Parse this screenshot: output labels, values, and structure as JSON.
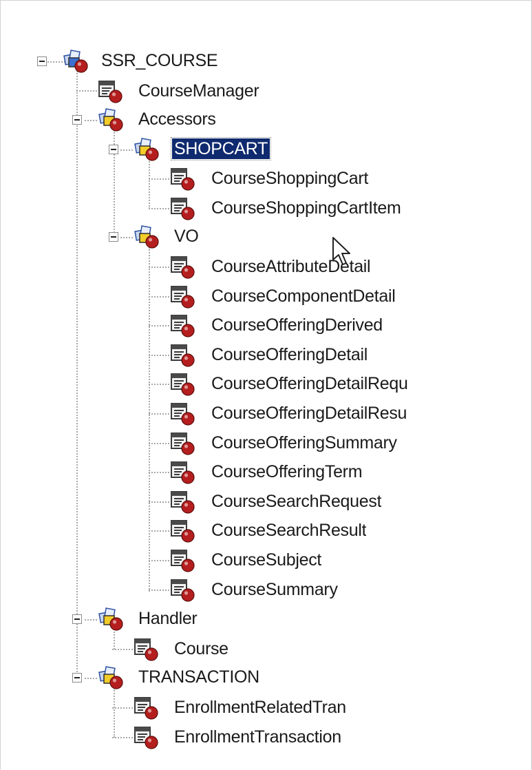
{
  "tree": {
    "root": {
      "label": "SSR_COURSE",
      "icon": "package-icon",
      "expanded": true
    },
    "course_manager": {
      "label": "CourseManager",
      "icon": "class-icon"
    },
    "accessors": {
      "label": "Accessors",
      "icon": "package-icon",
      "expanded": true
    },
    "shopcart": {
      "label": "SHOPCART",
      "icon": "package-icon",
      "expanded": true,
      "selected": true
    },
    "shopcart_items": [
      {
        "label": "CourseShoppingCart",
        "icon": "class-icon"
      },
      {
        "label": "CourseShoppingCartItem",
        "icon": "class-icon"
      }
    ],
    "vo": {
      "label": "VO",
      "icon": "package-icon",
      "expanded": true
    },
    "vo_items": [
      {
        "label": "CourseAttributeDetail",
        "icon": "class-icon"
      },
      {
        "label": "CourseComponentDetail",
        "icon": "class-icon"
      },
      {
        "label": "CourseOfferingDerived",
        "icon": "class-icon"
      },
      {
        "label": "CourseOfferingDetail",
        "icon": "class-icon"
      },
      {
        "label": "CourseOfferingDetailRequ",
        "icon": "class-icon"
      },
      {
        "label": "CourseOfferingDetailResu",
        "icon": "class-icon"
      },
      {
        "label": "CourseOfferingSummary",
        "icon": "class-icon"
      },
      {
        "label": "CourseOfferingTerm",
        "icon": "class-icon"
      },
      {
        "label": "CourseSearchRequest",
        "icon": "class-icon"
      },
      {
        "label": "CourseSearchResult",
        "icon": "class-icon"
      },
      {
        "label": "CourseSubject",
        "icon": "class-icon"
      },
      {
        "label": "CourseSummary",
        "icon": "class-icon"
      }
    ],
    "handler": {
      "label": "Handler",
      "icon": "package-icon",
      "expanded": true
    },
    "handler_items": [
      {
        "label": "Course",
        "icon": "class-icon"
      }
    ],
    "transaction": {
      "label": "TRANSACTION",
      "icon": "package-icon",
      "expanded": true
    },
    "transaction_items": [
      {
        "label": "EnrollmentRelatedTran",
        "icon": "class-icon"
      },
      {
        "label": "EnrollmentTransaction",
        "icon": "class-icon"
      }
    ]
  },
  "colors": {
    "selection": "#0f2a6e",
    "tree_line": "#a8a8a8",
    "package_blue": "#3d6fd0",
    "package_yellow": "#f2cc2a",
    "class_red": "#b51e1e"
  }
}
